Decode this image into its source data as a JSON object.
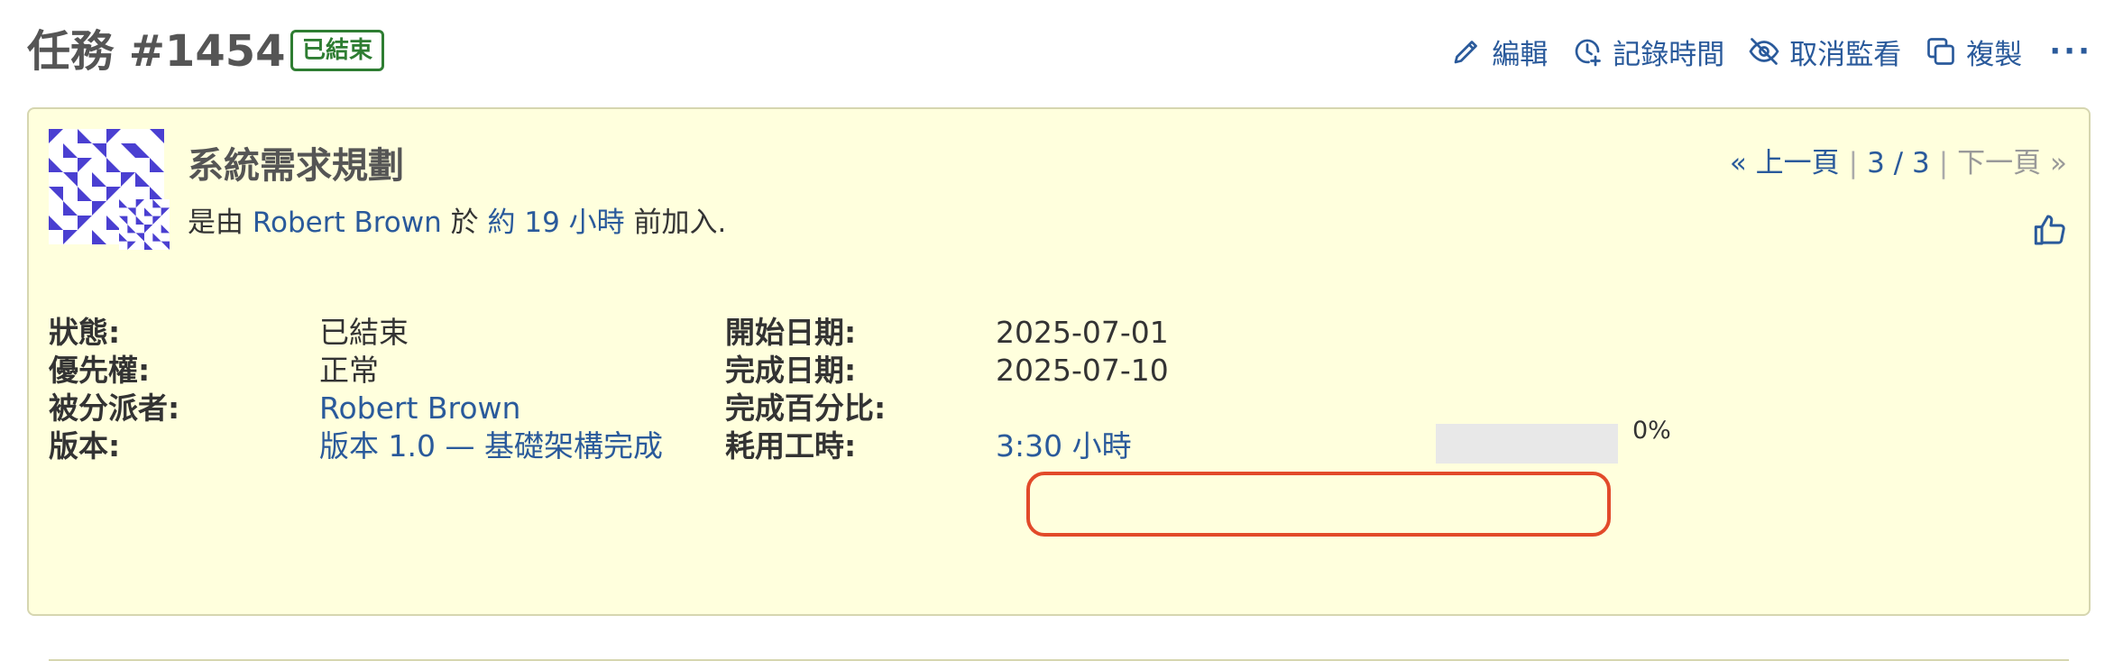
{
  "header": {
    "title": "任務 #1454",
    "status_badge": "已結束",
    "actions": {
      "edit": "編輯",
      "log_time": "記錄時間",
      "unwatch": "取消監看",
      "copy": "複製",
      "more": "···"
    }
  },
  "issue": {
    "subject": "系統需求規劃",
    "author_prefix": "是由",
    "author": "Robert Brown",
    "author_mid": "於",
    "age": "約 19 小時",
    "author_suffix": "前加入.",
    "pager": {
      "prev": "« 上一頁",
      "sep1": "|",
      "position": "3 / 3",
      "sep2": "|",
      "next": "下一頁 »"
    }
  },
  "attributes": {
    "status_label": "狀態:",
    "status_value": "已結束",
    "priority_label": "優先權:",
    "priority_value": "正常",
    "assignee_label": "被分派者:",
    "assignee_value": "Robert Brown",
    "version_label": "版本:",
    "version_value": "版本 1.0 — 基礎架構完成",
    "start_label": "開始日期:",
    "start_value": "2025-07-01",
    "due_label": "完成日期:",
    "due_value": "2025-07-10",
    "done_label": "完成百分比:",
    "done_value": "0%",
    "done_ratio": 0,
    "spent_label": "耗用工時:",
    "spent_value": "3:30 小時"
  },
  "colors": {
    "link": "#2a5a9b",
    "badge": "#2e7d32",
    "card_bg": "#ffffdd",
    "highlight": "#e24a2a",
    "avatar": "#4a3fd1"
  }
}
